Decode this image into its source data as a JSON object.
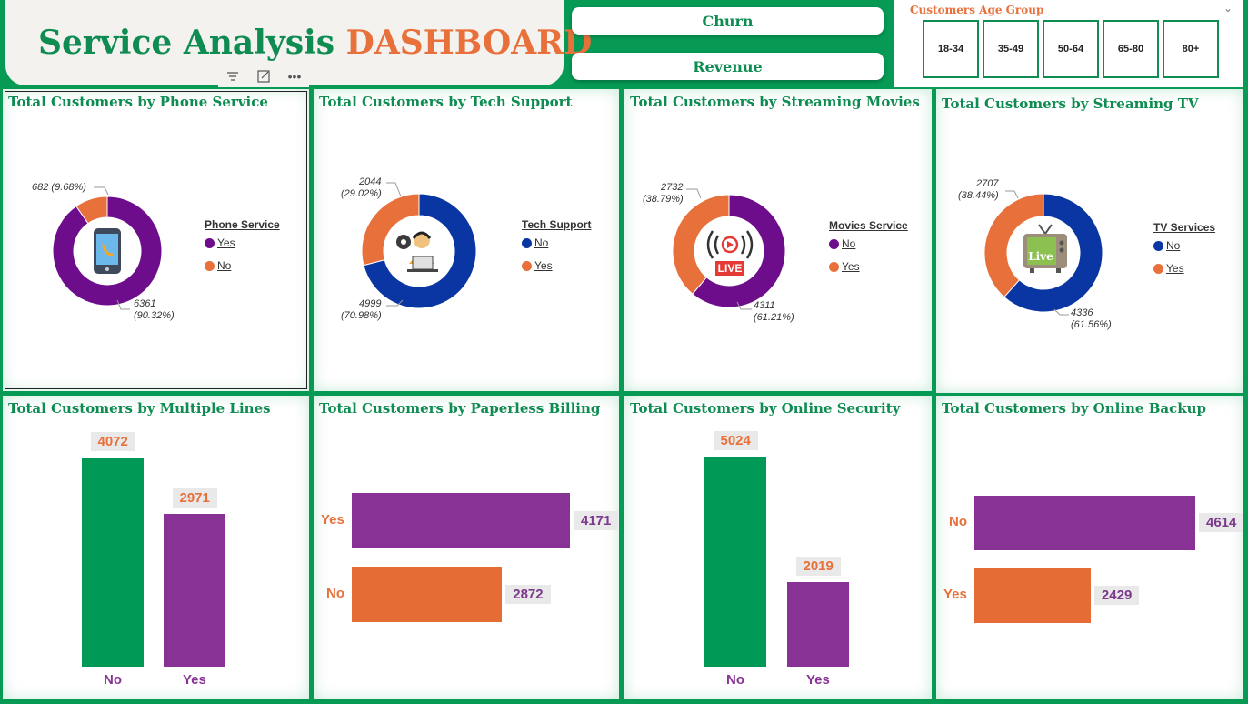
{
  "header": {
    "title_part1": "Service Analysis",
    "title_part2": "DASHBOARD"
  },
  "toolbar_icons": [
    "filter-icon",
    "focus-mode-icon",
    "more-options-icon"
  ],
  "nav": {
    "churn_label": "Churn",
    "revenue_label": "Revenue"
  },
  "slicer": {
    "title": "Customers Age Group",
    "items": [
      "18-34",
      "35-49",
      "50-64",
      "65-80",
      "80+"
    ]
  },
  "colors": {
    "green": "#069a55",
    "orange": "#e8703a",
    "purple": "#6e0d8c",
    "blue": "#0a36a3",
    "bar_purple": "#883295",
    "bar_green": "#009955",
    "bar_orange": "#e56c35"
  },
  "panels": {
    "phone_service": {
      "title": "Total Customers by Phone Service",
      "icon": "phone-icon",
      "legend_title": "Phone Service",
      "legend": [
        "Yes",
        "No"
      ],
      "label_small": "682 (9.68%)",
      "label_big_value": "6361",
      "label_big_pct": "(90.32%)"
    },
    "tech_support": {
      "title": "Total Customers by Tech Support",
      "icon": "tech-support-icon",
      "legend_title": "Tech Support",
      "legend": [
        "No",
        "Yes"
      ],
      "label_small_value": "2044",
      "label_small_pct": "(29.02%)",
      "label_big_value": "4999",
      "label_big_pct": "(70.98%)"
    },
    "streaming_movies": {
      "title": "Total Customers by Streaming Movies",
      "icon": "live-stream-icon",
      "icon_text": "LIVE",
      "legend_title": "Movies Service",
      "legend": [
        "No",
        "Yes"
      ],
      "label_small_value": "2732",
      "label_small_pct": "(38.79%)",
      "label_big_value": "4311",
      "label_big_pct": "(61.21%)"
    },
    "streaming_tv": {
      "title": "Total Customers by Streaming TV",
      "icon": "tv-icon",
      "icon_text": "Live",
      "legend_title": "TV Services",
      "legend": [
        "No",
        "Yes"
      ],
      "label_small_value": "2707",
      "label_small_pct": "(38.44%)",
      "label_big_value": "4336",
      "label_big_pct": "(61.56%)"
    },
    "multiple_lines": {
      "title": "Total Customers by Multiple Lines"
    },
    "paperless_billing": {
      "title": "Total Customers by Paperless Billing"
    },
    "online_security": {
      "title": "Total Customers by Online Security"
    },
    "online_backup": {
      "title": "Total Customers by Online Backup"
    }
  },
  "chart_data": [
    {
      "type": "pie",
      "donut": true,
      "title": "Total Customers by Phone Service",
      "legend_title": "Phone Service",
      "categories": [
        "Yes",
        "No"
      ],
      "values": [
        6361,
        682
      ],
      "percents": [
        90.32,
        9.68
      ],
      "colors": [
        "#6e0d8c",
        "#e8703a"
      ]
    },
    {
      "type": "pie",
      "donut": true,
      "title": "Total Customers by Tech Support",
      "legend_title": "Tech Support",
      "categories": [
        "No",
        "Yes"
      ],
      "values": [
        4999,
        2044
      ],
      "percents": [
        70.98,
        29.02
      ],
      "colors": [
        "#0a36a3",
        "#e8703a"
      ]
    },
    {
      "type": "pie",
      "donut": true,
      "title": "Total Customers by Streaming Movies",
      "legend_title": "Movies Service",
      "categories": [
        "No",
        "Yes"
      ],
      "values": [
        4311,
        2732
      ],
      "percents": [
        61.21,
        38.79
      ],
      "colors": [
        "#6e0d8c",
        "#e8703a"
      ]
    },
    {
      "type": "pie",
      "donut": true,
      "title": "Total Customers by Streaming TV",
      "legend_title": "TV Services",
      "categories": [
        "No",
        "Yes"
      ],
      "values": [
        4336,
        2707
      ],
      "percents": [
        61.56,
        38.44
      ],
      "colors": [
        "#0a36a3",
        "#e8703a"
      ]
    },
    {
      "type": "bar",
      "orientation": "vertical",
      "title": "Total Customers by Multiple Lines",
      "categories": [
        "No",
        "Yes"
      ],
      "values": [
        4072,
        2971
      ],
      "colors": [
        "#009955",
        "#883295"
      ],
      "label_colors": [
        "#883295",
        "#883295"
      ]
    },
    {
      "type": "bar",
      "orientation": "horizontal",
      "title": "Total Customers by Paperless Billing",
      "categories": [
        "Yes",
        "No"
      ],
      "values": [
        4171,
        2872
      ],
      "colors": [
        "#883295",
        "#e56c35"
      ],
      "label_colors": [
        "#e8703a",
        "#e8703a"
      ]
    },
    {
      "type": "bar",
      "orientation": "vertical",
      "title": "Total Customers by Online Security",
      "categories": [
        "No",
        "Yes"
      ],
      "values": [
        5024,
        2019
      ],
      "colors": [
        "#009955",
        "#883295"
      ],
      "label_colors": [
        "#883295",
        "#883295"
      ]
    },
    {
      "type": "bar",
      "orientation": "horizontal",
      "title": "Total Customers by Online Backup",
      "categories": [
        "No",
        "Yes"
      ],
      "values": [
        4614,
        2429
      ],
      "colors": [
        "#883295",
        "#e56c35"
      ],
      "label_colors": [
        "#e8703a",
        "#e8703a"
      ]
    }
  ]
}
